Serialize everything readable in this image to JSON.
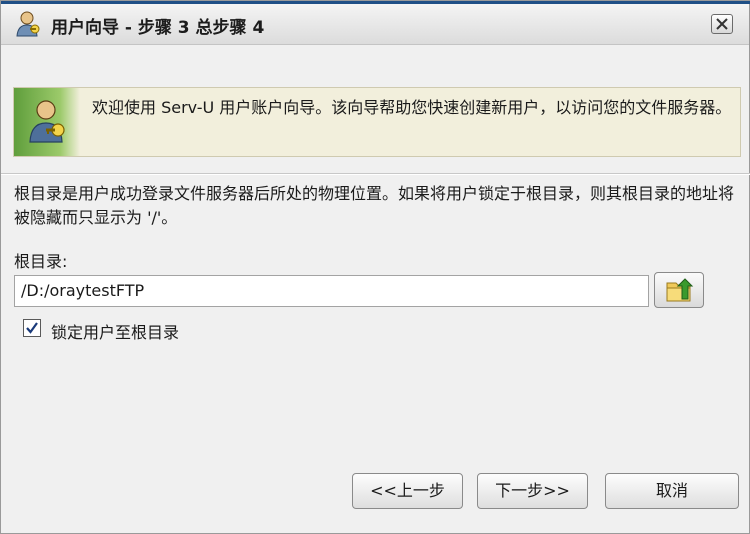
{
  "window": {
    "title": "用户向导 - 步骤 3 总步骤 4",
    "icon": "user-wizard-icon",
    "close_icon": "close-icon"
  },
  "banner": {
    "icon": "user-key-icon",
    "text": "欢迎使用 Serv-U 用户账户向导。该向导帮助您快速创建新用户，以访问您的文件服务器。"
  },
  "content": {
    "description": "根目录是用户成功登录文件服务器后所处的物理位置。如果将用户锁定于根目录，则其根目录的地址将被隐藏而只显示为 '/'。",
    "root_label": "根目录:",
    "root_value": "/D:/oraytestFTP",
    "browse_icon": "folder-up-icon",
    "lock_checkbox": {
      "label": "锁定用户至根目录",
      "checked": true
    }
  },
  "buttons": {
    "prev": "<<上一步",
    "next": "下一步>>",
    "cancel": "取消"
  },
  "colors": {
    "title_bar_top": "#1f4f86",
    "banner_bg": "#f2efdc",
    "banner_icon_green": "#5f9e3c"
  }
}
